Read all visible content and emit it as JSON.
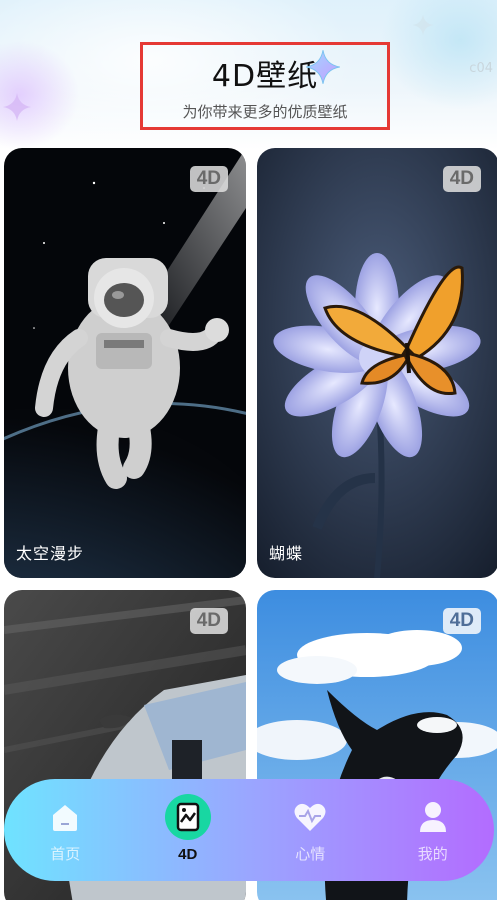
{
  "header": {
    "title": "4D壁纸",
    "subtitle": "为你带来更多的优质壁纸",
    "corner_text": "c04"
  },
  "badge_label": "4D",
  "cards": [
    {
      "label": "太空漫步",
      "badge": "4D"
    },
    {
      "label": "蝴蝶",
      "badge": "4D"
    },
    {
      "label": "",
      "badge": "4D"
    },
    {
      "label": "",
      "badge": "4D"
    }
  ],
  "nav": {
    "items": [
      {
        "label": "首页",
        "icon": "home-icon",
        "active": false
      },
      {
        "label": "4D",
        "icon": "wallpaper-icon",
        "active": true
      },
      {
        "label": "心情",
        "icon": "heart-pulse-icon",
        "active": false
      },
      {
        "label": "我的",
        "icon": "profile-icon",
        "active": false
      }
    ]
  },
  "colors": {
    "accent_active": "#18d7a2",
    "nav_gradient_start": "#6fe3ff",
    "nav_gradient_end": "#b36cff",
    "highlight_box": "#e53935"
  }
}
